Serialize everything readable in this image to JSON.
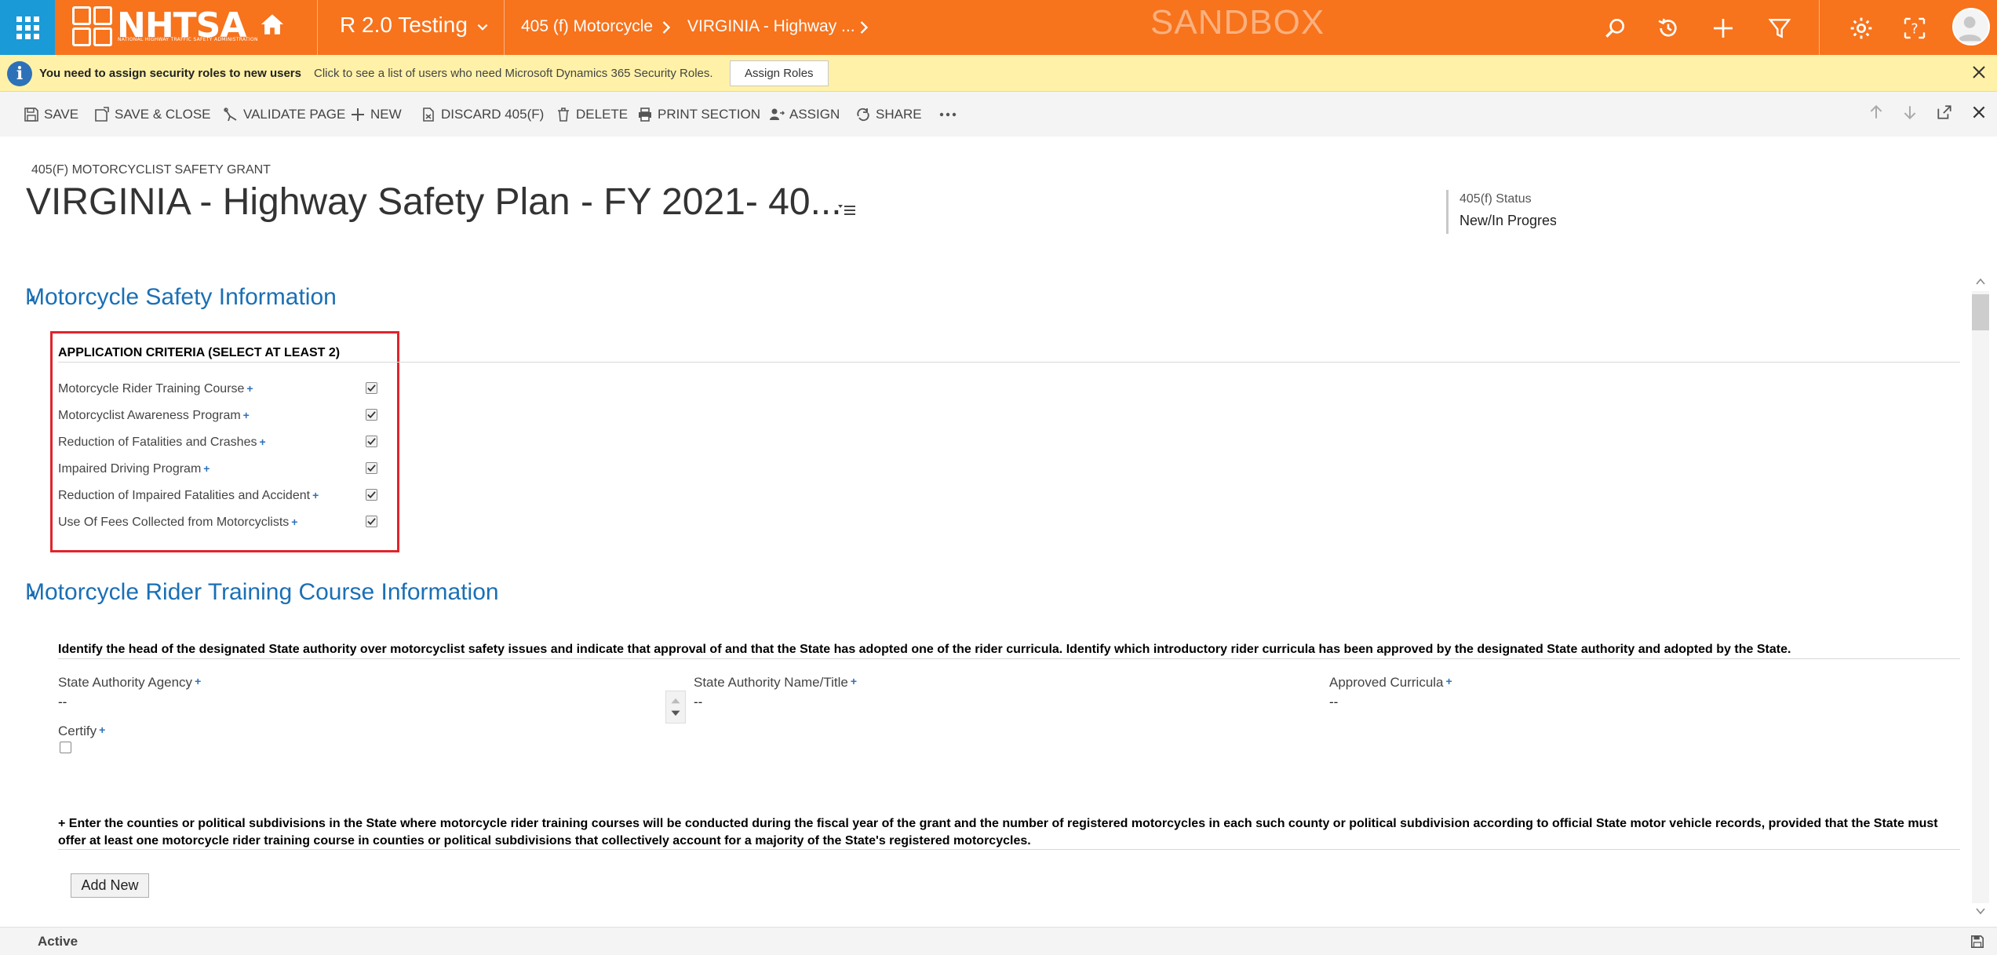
{
  "topbar": {
    "logo_text": "NHTSA",
    "logo_subtext": "NATIONAL HIGHWAY TRAFFIC SAFETY ADMINISTRATION",
    "app_name": "R 2.0 Testing",
    "breadcrumbs": [
      "405 (f) Motorcycle",
      "VIRGINIA - Highway ..."
    ],
    "environment_label": "SANDBOX",
    "icons": [
      "search-icon",
      "history-icon",
      "plus-icon",
      "filter-icon",
      "gear-icon",
      "help-icon",
      "avatar-icon"
    ],
    "colors": {
      "bar": "#f7731c",
      "waffle": "#1b9ad8"
    }
  },
  "notification": {
    "title": "You need to assign security roles to new users",
    "message": "Click to see a list of users who need Microsoft Dynamics 365 Security Roles.",
    "button_label": "Assign Roles"
  },
  "commands": [
    {
      "label": "SAVE",
      "icon": "save-icon"
    },
    {
      "label": "SAVE & CLOSE",
      "icon": "save-close-icon"
    },
    {
      "label": "VALIDATE PAGE",
      "icon": "validate-icon"
    },
    {
      "label": "NEW",
      "icon": "plus-icon"
    },
    {
      "label": "DISCARD 405(F)",
      "icon": "discard-icon"
    },
    {
      "label": "DELETE",
      "icon": "trash-icon"
    },
    {
      "label": "PRINT SECTION",
      "icon": "print-icon"
    },
    {
      "label": "ASSIGN",
      "icon": "assign-icon"
    },
    {
      "label": "SHARE",
      "icon": "share-icon"
    }
  ],
  "form": {
    "entity_label": "405(F) MOTORCYCLIST SAFETY GRANT",
    "title": "VIRGINIA - Highway Safety Plan - FY 2021- 40...",
    "status_label": "405(f) Status",
    "status_value": "New/In Progress"
  },
  "section1": {
    "title": "Motorcycle Safety Information",
    "criteria_header": "APPLICATION CRITERIA (SELECT AT LEAST 2)",
    "criteria": [
      {
        "label": "Motorcycle Rider Training Course",
        "checked": true
      },
      {
        "label": "Motorcyclist Awareness Program",
        "checked": true
      },
      {
        "label": "Reduction of Fatalities and Crashes",
        "checked": true
      },
      {
        "label": "Impaired Driving Program",
        "checked": true
      },
      {
        "label": "Reduction of Impaired Fatalities and Accident",
        "checked": true
      },
      {
        "label": "Use Of Fees Collected from Motorcyclists",
        "checked": true
      }
    ],
    "required_marker": "+"
  },
  "section2": {
    "title": "Motorcycle Rider Training Course Information",
    "instructions": "Identify the head of the designated State authority over motorcyclist safety issues and indicate that approval of and that the State has adopted one of the rider curricula. Identify which introductory rider curricula has been approved by the designated State authority and adopted by the State.",
    "fields": [
      {
        "label": "State Authority Agency",
        "value": "--"
      },
      {
        "label": "State Authority Name/Title",
        "value": "--"
      },
      {
        "label": "Approved Curricula",
        "value": "--"
      }
    ],
    "certify_label": "Certify",
    "counties_instructions": "+ Enter the counties or political subdivisions in the State where motorcycle rider training courses will be conducted during the fiscal year of the grant and the number of registered motorcycles in each such county or political subdivision according to official State motor vehicle records, provided that the State must offer at least one motorcycle rider training course in counties or political subdivisions that collectively account for a majority of the State's registered motorcycles.",
    "add_new_label": "Add New"
  },
  "statusbar": {
    "state": "Active"
  }
}
